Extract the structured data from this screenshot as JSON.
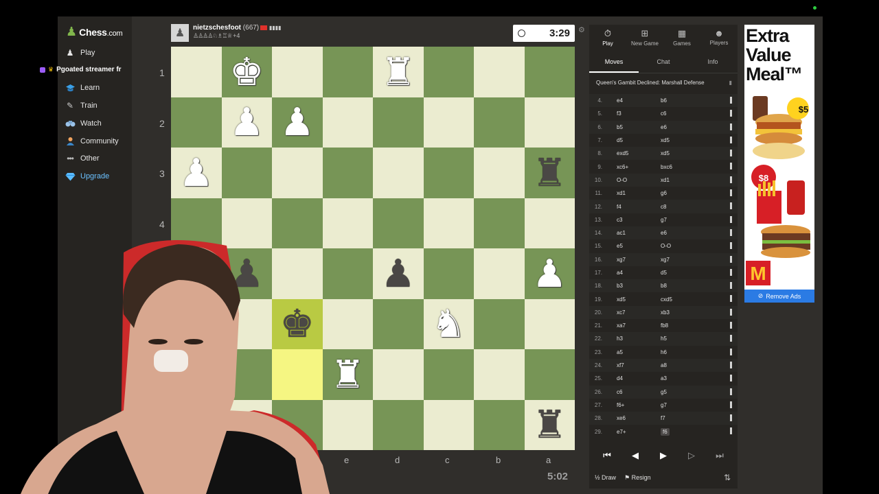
{
  "brand": {
    "logo_text": "Chess",
    "logo_domain": ".com"
  },
  "nav": {
    "pinned_text": "Pgoated streamer fr",
    "items": [
      {
        "label": "Play",
        "icon": "play-pawn-icon"
      },
      {
        "label": "Learn",
        "icon": "learn-icon"
      },
      {
        "label": "Train",
        "icon": "train-icon"
      },
      {
        "label": "Watch",
        "icon": "watch-icon"
      },
      {
        "label": "Community",
        "icon": "community-icon"
      },
      {
        "label": "Other",
        "icon": "more-icon"
      },
      {
        "label": "Upgrade",
        "icon": "diamond-icon"
      }
    ]
  },
  "opponent": {
    "name": "nietzschesfoot",
    "rating": "(667)",
    "captured_extra": "+4",
    "clock": "3:29"
  },
  "self": {
    "clock": "5:02"
  },
  "board": {
    "ranks": [
      "1",
      "2",
      "3",
      "4"
    ],
    "files": [
      "e",
      "d",
      "c",
      "b",
      "a"
    ]
  },
  "panel": {
    "tabs": [
      "Play",
      "New Game",
      "Games",
      "Players"
    ],
    "subtabs": [
      "Moves",
      "Chat",
      "Info"
    ],
    "opening": "Queen's Gambit Declined: Marshall Defense",
    "moves": [
      {
        "n": "4.",
        "w": "e4",
        "b": "b6"
      },
      {
        "n": "5.",
        "w": "f3",
        "b": "c6"
      },
      {
        "n": "6.",
        "w": "b5",
        "b": "e6"
      },
      {
        "n": "7.",
        "w": "d5",
        "b": "xd5"
      },
      {
        "n": "8.",
        "w": "exd5",
        "b": "xd5"
      },
      {
        "n": "9.",
        "w": "xc6+",
        "b": "bxc6"
      },
      {
        "n": "10.",
        "w": "O-O",
        "b": "xd1"
      },
      {
        "n": "11.",
        "w": "xd1",
        "b": "g6"
      },
      {
        "n": "12.",
        "w": "f4",
        "b": "c8"
      },
      {
        "n": "13.",
        "w": "c3",
        "b": "g7"
      },
      {
        "n": "14.",
        "w": "ac1",
        "b": "e6"
      },
      {
        "n": "15.",
        "w": "e5",
        "b": "O-O"
      },
      {
        "n": "16.",
        "w": "xg7",
        "b": "xg7"
      },
      {
        "n": "17.",
        "w": "a4",
        "b": "d5"
      },
      {
        "n": "18.",
        "w": "b3",
        "b": "b8"
      },
      {
        "n": "19.",
        "w": "xd5",
        "b": "cxd5"
      },
      {
        "n": "20.",
        "w": "xc7",
        "b": "xb3"
      },
      {
        "n": "21.",
        "w": "xa7",
        "b": "fb8"
      },
      {
        "n": "22.",
        "w": "h3",
        "b": "h5"
      },
      {
        "n": "23.",
        "w": "a5",
        "b": "h6"
      },
      {
        "n": "24.",
        "w": "xf7",
        "b": "a8"
      },
      {
        "n": "25.",
        "w": "d4",
        "b": "a3"
      },
      {
        "n": "26.",
        "w": "c6",
        "b": "g5"
      },
      {
        "n": "27.",
        "w": "f6+",
        "b": "g7"
      },
      {
        "n": "28.",
        "w": "xe6",
        "b": "f7"
      },
      {
        "n": "29.",
        "w": "e7+",
        "b": "f6"
      }
    ],
    "draw_label": "Draw",
    "resign_label": "Resign"
  },
  "ad": {
    "headline": "Extra Value Meal™",
    "price1": "$5",
    "price2": "$8",
    "remove_label": "Remove Ads"
  }
}
